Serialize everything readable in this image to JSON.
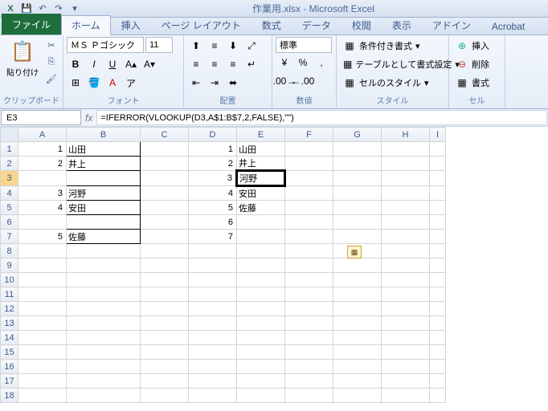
{
  "title": "作業用.xlsx - Microsoft Excel",
  "tabs": {
    "file": "ファイル",
    "home": "ホーム",
    "insert": "挿入",
    "layout": "ページ レイアウト",
    "formulas": "数式",
    "data": "データ",
    "review": "校閲",
    "view": "表示",
    "addin": "アドイン",
    "acrobat": "Acrobat"
  },
  "clipboard": {
    "paste": "貼り付け",
    "label": "クリップボード"
  },
  "font": {
    "name": "ＭＳ Ｐゴシック",
    "size": "11",
    "label": "フォント"
  },
  "align": {
    "label": "配置"
  },
  "number": {
    "style": "標準",
    "label": "数値"
  },
  "styles": {
    "cond": "条件付き書式",
    "table": "テーブルとして書式設定",
    "cell": "セルのスタイル",
    "label": "スタイル"
  },
  "cells": {
    "insert": "挿入",
    "delete": "削除",
    "format": "書式",
    "label": "セル"
  },
  "namebox": "E3",
  "formula": "=IFERROR(VLOOKUP(D3,A$1:B$7,2,FALSE),\"\")",
  "cols": [
    "A",
    "B",
    "C",
    "D",
    "E",
    "F",
    "G",
    "H",
    "I"
  ],
  "rows": [
    "1",
    "2",
    "3",
    "4",
    "5",
    "6",
    "7",
    "8",
    "9",
    "10",
    "11",
    "12",
    "13",
    "14",
    "15",
    "16",
    "17",
    "18"
  ],
  "data": {
    "A1": "1",
    "B1": "山田",
    "A2": "2",
    "B2": "井上",
    "A4": "3",
    "B4": "河野",
    "A5": "4",
    "B5": "安田",
    "A7": "5",
    "B7": "佐藤",
    "D1": "1",
    "E1": "山田",
    "D2": "2",
    "E2": "井上",
    "D3": "3",
    "E3": "河野",
    "D4": "4",
    "E4": "安田",
    "D5": "5",
    "E5": "佐藤",
    "D6": "6",
    "D7": "7"
  }
}
